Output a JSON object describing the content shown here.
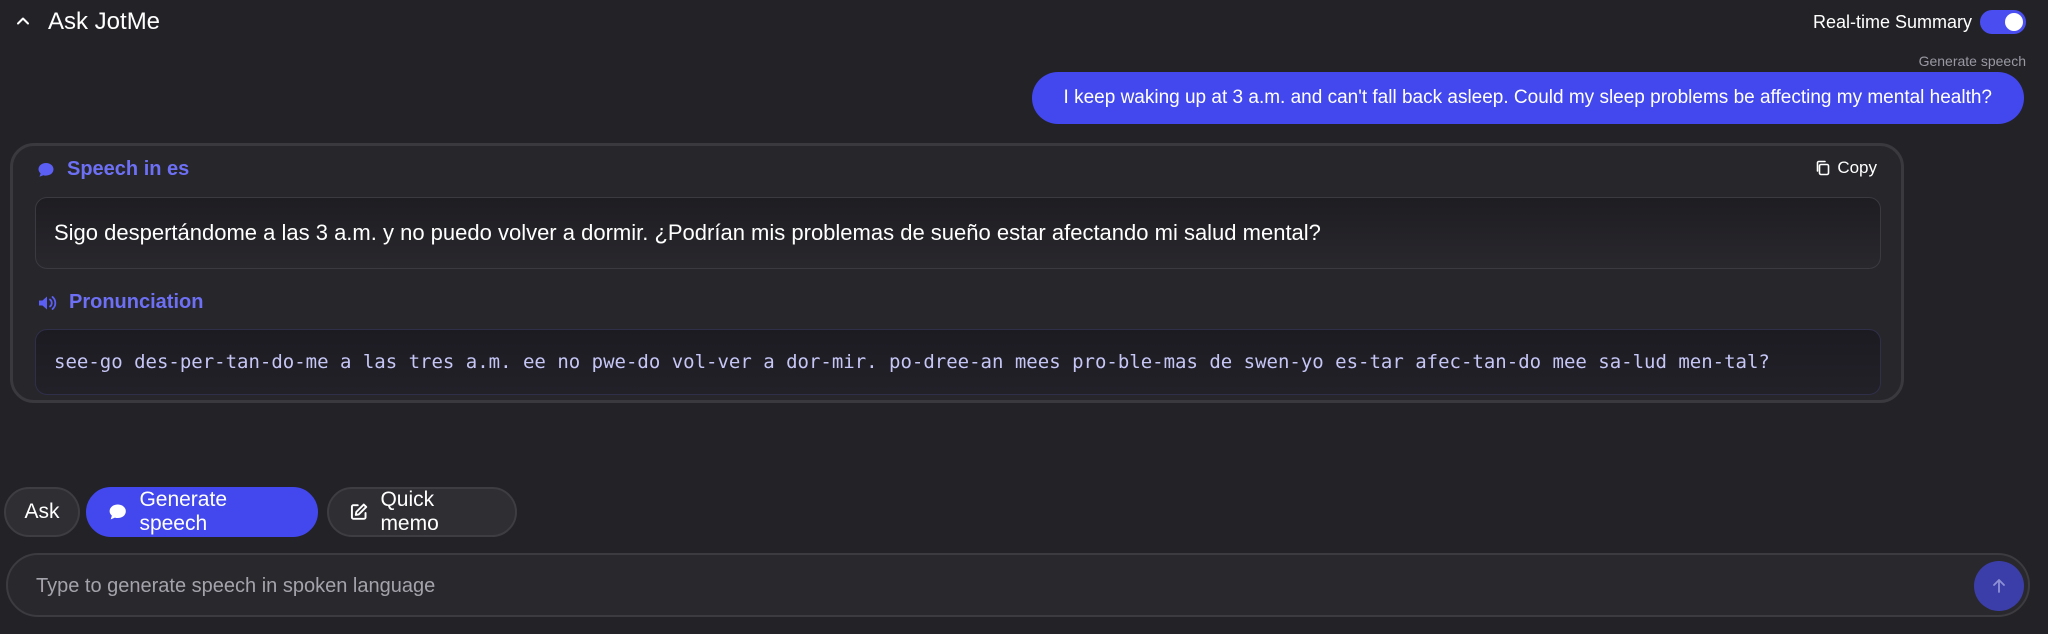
{
  "header": {
    "title": "Ask JotMe",
    "realtime_label": "Real-time Summary",
    "realtime_enabled": true
  },
  "conversation": {
    "mode_caption": "Generate speech",
    "user_message": "I keep waking up at 3 a.m. and can't fall back asleep. Could my sleep problems be affecting my mental health?"
  },
  "result": {
    "speech_title": "Speech in es",
    "copy_label": "Copy",
    "speech_text": "Sigo despertándome a las 3 a.m. y no puedo volver a dormir. ¿Podrían mis problemas de sueño estar afectando mi salud mental?",
    "pronunciation_title": "Pronunciation",
    "pronunciation_text": "see-go des-per-tan-do-me a las tres a.m. ee no pwe-do vol-ver a dor-mir. po-dree-an mees pro-ble-mas de swen-yo es-tar afec-tan-do mee sa-lud men-tal?"
  },
  "modes": {
    "ask": "Ask",
    "generate_speech": "Generate speech",
    "quick_memo": "Quick memo",
    "active": "generate_speech"
  },
  "input": {
    "placeholder": "Type to generate speech in spoken language",
    "value": ""
  },
  "colors": {
    "background": "#232227",
    "accent": "#4348ee",
    "accent_text": "#6d70f4"
  }
}
